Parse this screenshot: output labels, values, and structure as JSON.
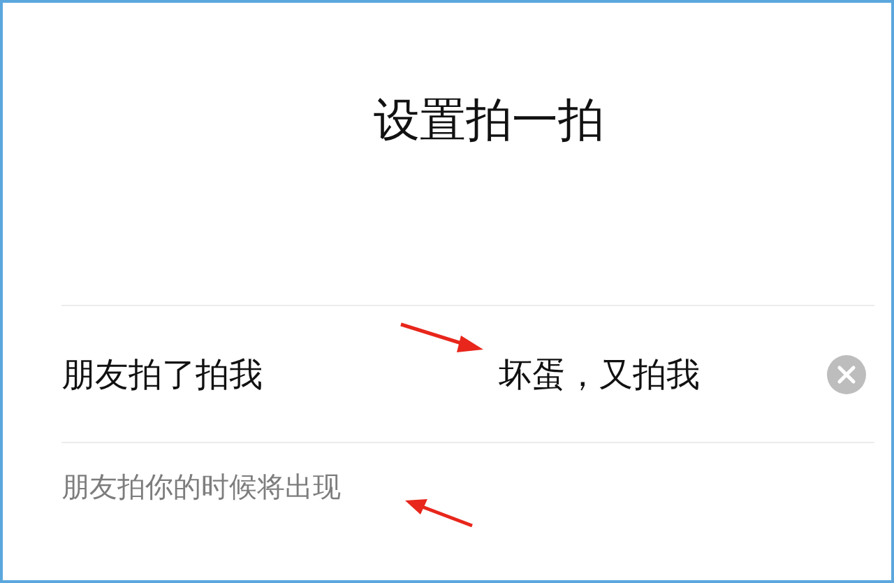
{
  "title": "设置拍一拍",
  "field": {
    "label": "朋友拍了拍我",
    "value": "坏蛋，又拍我"
  },
  "hint": "朋友拍你的时候将出现"
}
